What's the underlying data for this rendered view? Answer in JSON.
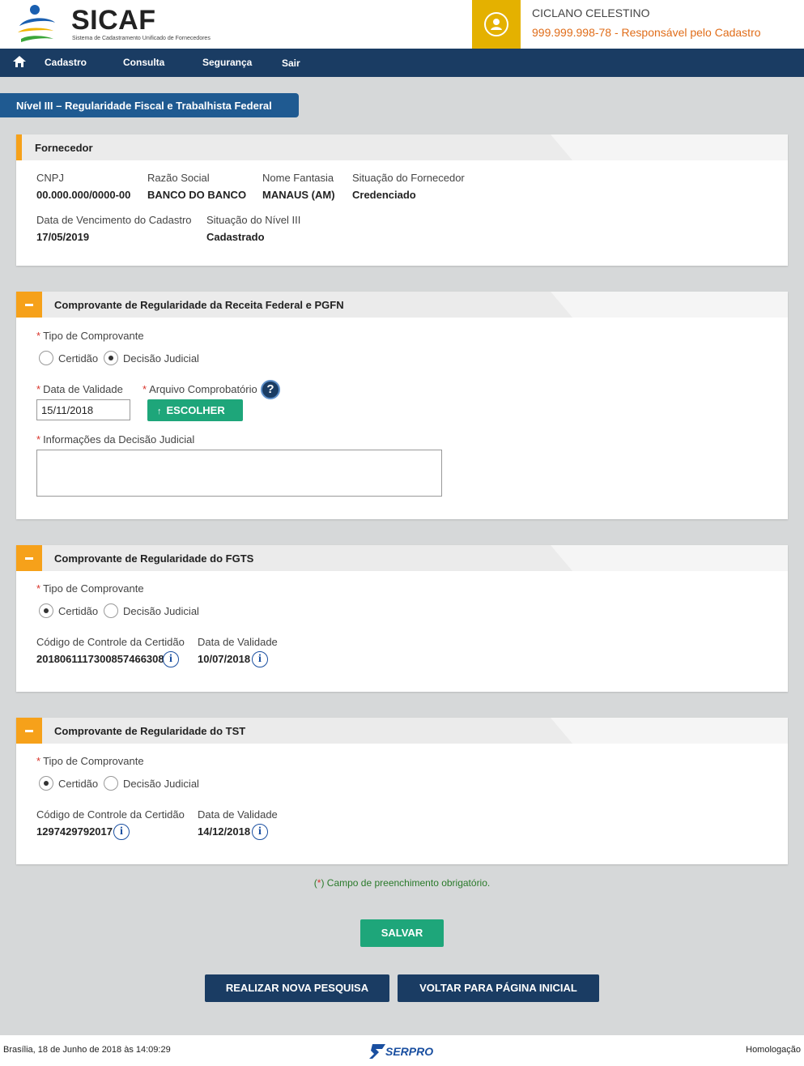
{
  "header": {
    "app_name": "SICAF",
    "app_subtitle": "Sistema de Cadastramento Unificado de Fornecedores",
    "user_name": "CICLANO CELESTINO",
    "user_role": "999.999.998-78 - Responsável pelo Cadastro"
  },
  "nav": {
    "items": [
      "Cadastro",
      "Consulta",
      "Segurança",
      "Sair"
    ]
  },
  "page_title": "Nível III – Regularidade Fiscal e Trabalhista Federal",
  "fornecedor": {
    "title": "Fornecedor",
    "cnpj_label": "CNPJ",
    "cnpj": "00.000.000/0000-00",
    "razao_label": "Razão Social",
    "razao": "BANCO DO BANCO",
    "fantasia_label": "Nome Fantasia",
    "fantasia": "MANAUS (AM)",
    "situacao_label": "Situação do Fornecedor",
    "situacao": "Credenciado",
    "vencimento_label": "Data de Vencimento do Cadastro",
    "vencimento": "17/05/2019",
    "nivel_label": "Situação do Nível III",
    "nivel": "Cadastrado"
  },
  "receita": {
    "title": "Comprovante de Regularidade da Receita Federal e PGFN",
    "tipo_label": "Tipo de Comprovante",
    "opt_certidao": "Certidão",
    "opt_decisao": "Decisão Judicial",
    "selected": "Decisão Judicial",
    "validade_label": "Data de Validade",
    "validade": "15/11/2018",
    "arquivo_label": "Arquivo Comprobatório",
    "choose_button": "ESCOLHER",
    "info_label": "Informações da Decisão Judicial",
    "info_value": ""
  },
  "fgts": {
    "title": "Comprovante de Regularidade do FGTS",
    "tipo_label": "Tipo de Comprovante",
    "opt_certidao": "Certidão",
    "opt_decisao": "Decisão Judicial",
    "selected": "Certidão",
    "codigo_label": "Código de Controle da Certidão",
    "codigo": "2018061117300857466308",
    "validade_label": "Data de Validade",
    "validade": "10/07/2018"
  },
  "tst": {
    "title": "Comprovante de Regularidade do TST",
    "tipo_label": "Tipo de Comprovante",
    "opt_certidao": "Certidão",
    "opt_decisao": "Decisão Judicial",
    "selected": "Certidão",
    "codigo_label": "Código de Controle da Certidão",
    "codigo": "1297429792017",
    "validade_label": "Data de Validade",
    "validade": "14/12/2018"
  },
  "required_star": "*",
  "mandatory_note": "Campo de preenchimento obrigatório.",
  "mandatory_star": "(*)",
  "buttons": {
    "save": "SALVAR",
    "new_search": "REALIZAR NOVA PESQUISA",
    "back_home": "VOLTAR PARA PÁGINA INICIAL"
  },
  "footer": {
    "datetime": "Brasília, 18 de Junho de 2018 às 14:09:29",
    "logo_text": "SERPRO",
    "environment": "Homologação"
  },
  "icons": {
    "home": "home-icon",
    "user": "user-icon",
    "collapse": "minus-icon",
    "help": "question-icon",
    "info": "info-icon",
    "upload": "arrow-up-icon"
  },
  "colors": {
    "navy": "#1a3c63",
    "accent_orange": "#f6a11a",
    "green_button": "#1ea67a",
    "user_gold": "#e4b100",
    "role_orange": "#e06d1a"
  }
}
